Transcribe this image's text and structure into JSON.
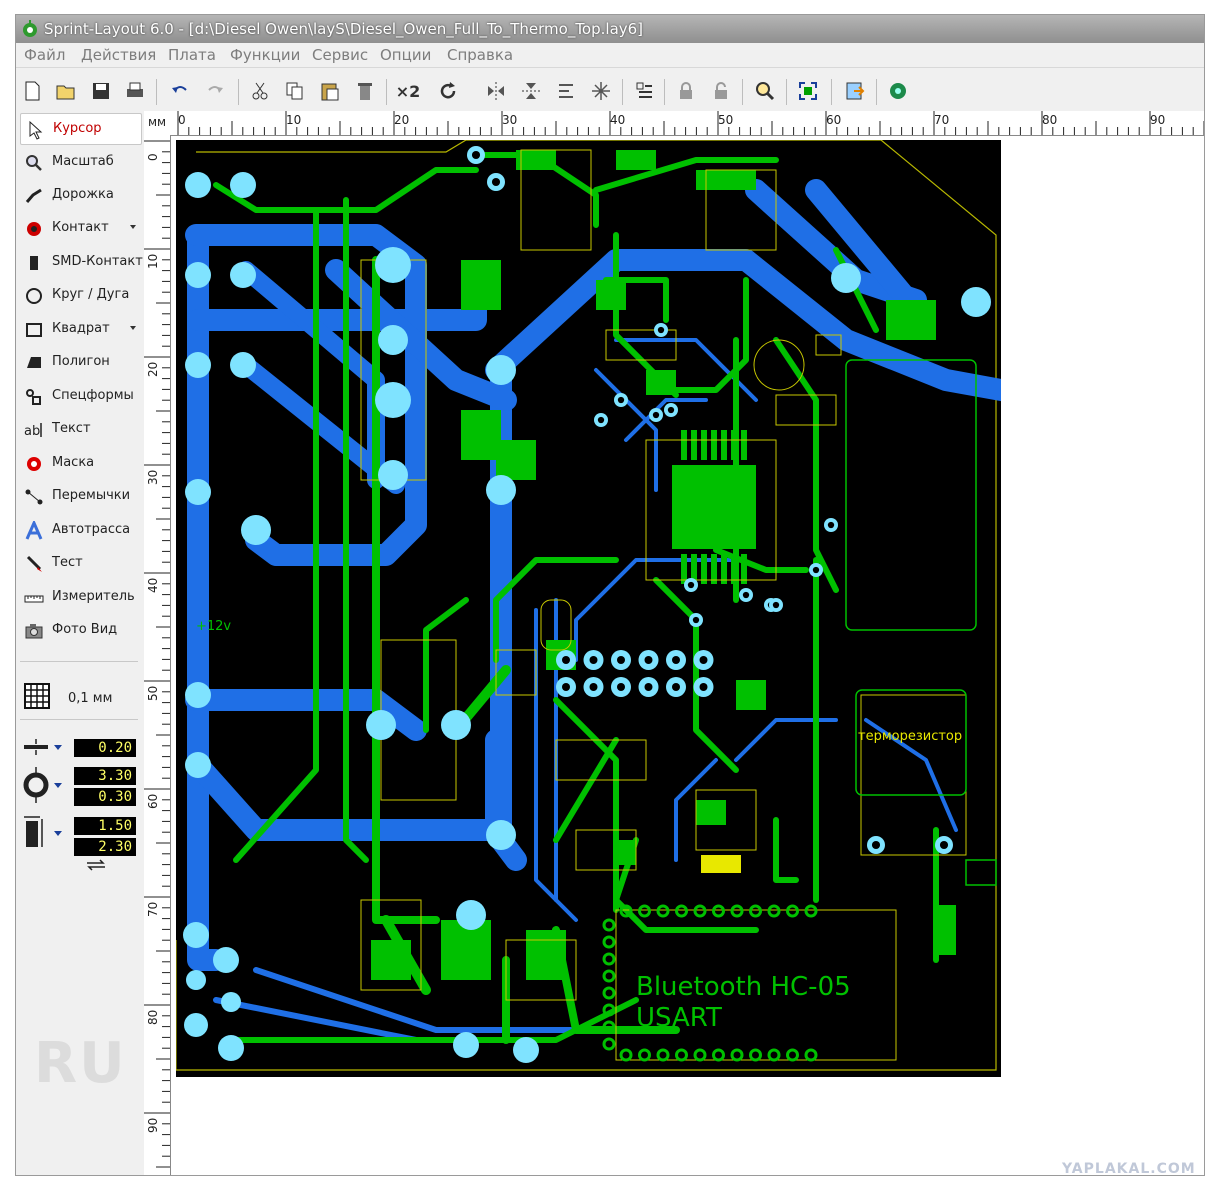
{
  "window": {
    "title": "Sprint-Layout 6.0 - [d:\\Diesel Owen\\layS\\Diesel_Owen_Full_To_Thermo_Top.lay6]"
  },
  "menu": [
    "Файл",
    "Действия",
    "Плата",
    "Функции",
    "Сервис",
    "Опции",
    "Справка"
  ],
  "toolbar": {
    "mirror_x2": "×2",
    "icons": [
      "new-file-icon",
      "open-folder-icon",
      "save-icon",
      "print-icon",
      "undo-icon",
      "redo-icon",
      "cut-icon",
      "copy-icon",
      "paste-icon",
      "delete-icon",
      "multiply-icon",
      "rotate-icon",
      "mirror-horizontal-icon",
      "mirror-vertical-icon",
      "align-icon",
      "group-icon",
      "ungroup-icon",
      "list-icon",
      "lock-icon",
      "unlock-icon",
      "search-icon",
      "zoom-fit-icon",
      "import-icon",
      "component-icon"
    ]
  },
  "tools": [
    {
      "label": "Курсор",
      "icon": "cursor-arrow-icon",
      "active": true
    },
    {
      "label": "Масштаб",
      "icon": "magnifier-icon"
    },
    {
      "label": "Дорожка",
      "icon": "track-icon"
    },
    {
      "label": "Контакт",
      "icon": "pad-icon",
      "dropdown": true
    },
    {
      "label": "SMD-Контакт",
      "icon": "smd-pad-icon"
    },
    {
      "label": "Круг / Дуга",
      "icon": "circle-arc-icon"
    },
    {
      "label": "Квадрат",
      "icon": "square-icon",
      "dropdown": true
    },
    {
      "label": "Полигон",
      "icon": "polygon-icon"
    },
    {
      "label": "Спецформы",
      "icon": "special-shapes-icon"
    },
    {
      "label": "Текст",
      "icon": "text-icon"
    },
    {
      "label": "Маска",
      "icon": "mask-icon"
    },
    {
      "label": "Перемычки",
      "icon": "jumper-icon"
    },
    {
      "label": "Автотрасса",
      "icon": "autoroute-icon"
    },
    {
      "label": "Тест",
      "icon": "test-probe-icon"
    },
    {
      "label": "Измеритель",
      "icon": "ruler-icon"
    },
    {
      "label": "Фото Вид",
      "icon": "camera-icon"
    }
  ],
  "grid": {
    "label": "0,1 мм"
  },
  "params": {
    "track_width": "0.20",
    "pad_outer": "3.30",
    "pad_inner": "0.30",
    "smd_width": "1.50",
    "smd_height": "2.30"
  },
  "ruler": {
    "unit": "мм",
    "x_ticks": [
      "0",
      "10",
      "20",
      "30",
      "40",
      "50",
      "60",
      "70",
      "80",
      "90"
    ],
    "y_ticks": [
      "0",
      "10",
      "20",
      "30",
      "40",
      "50",
      "60",
      "70",
      "80",
      "90"
    ]
  },
  "board": {
    "labels": {
      "voltage": "+12v",
      "thermistor": "терморезистор",
      "bluetooth_line1": "Bluetooth HC-05",
      "bluetooth_line2": "USART"
    },
    "colors": {
      "background": "#000000",
      "top_copper": "#00c000",
      "bottom_copper": "#1f6fe6",
      "silkscreen": "#e8e800",
      "pad": "#7fe3ff"
    }
  },
  "watermark": "RU",
  "site_watermark": "YAPLAKAL.COM"
}
